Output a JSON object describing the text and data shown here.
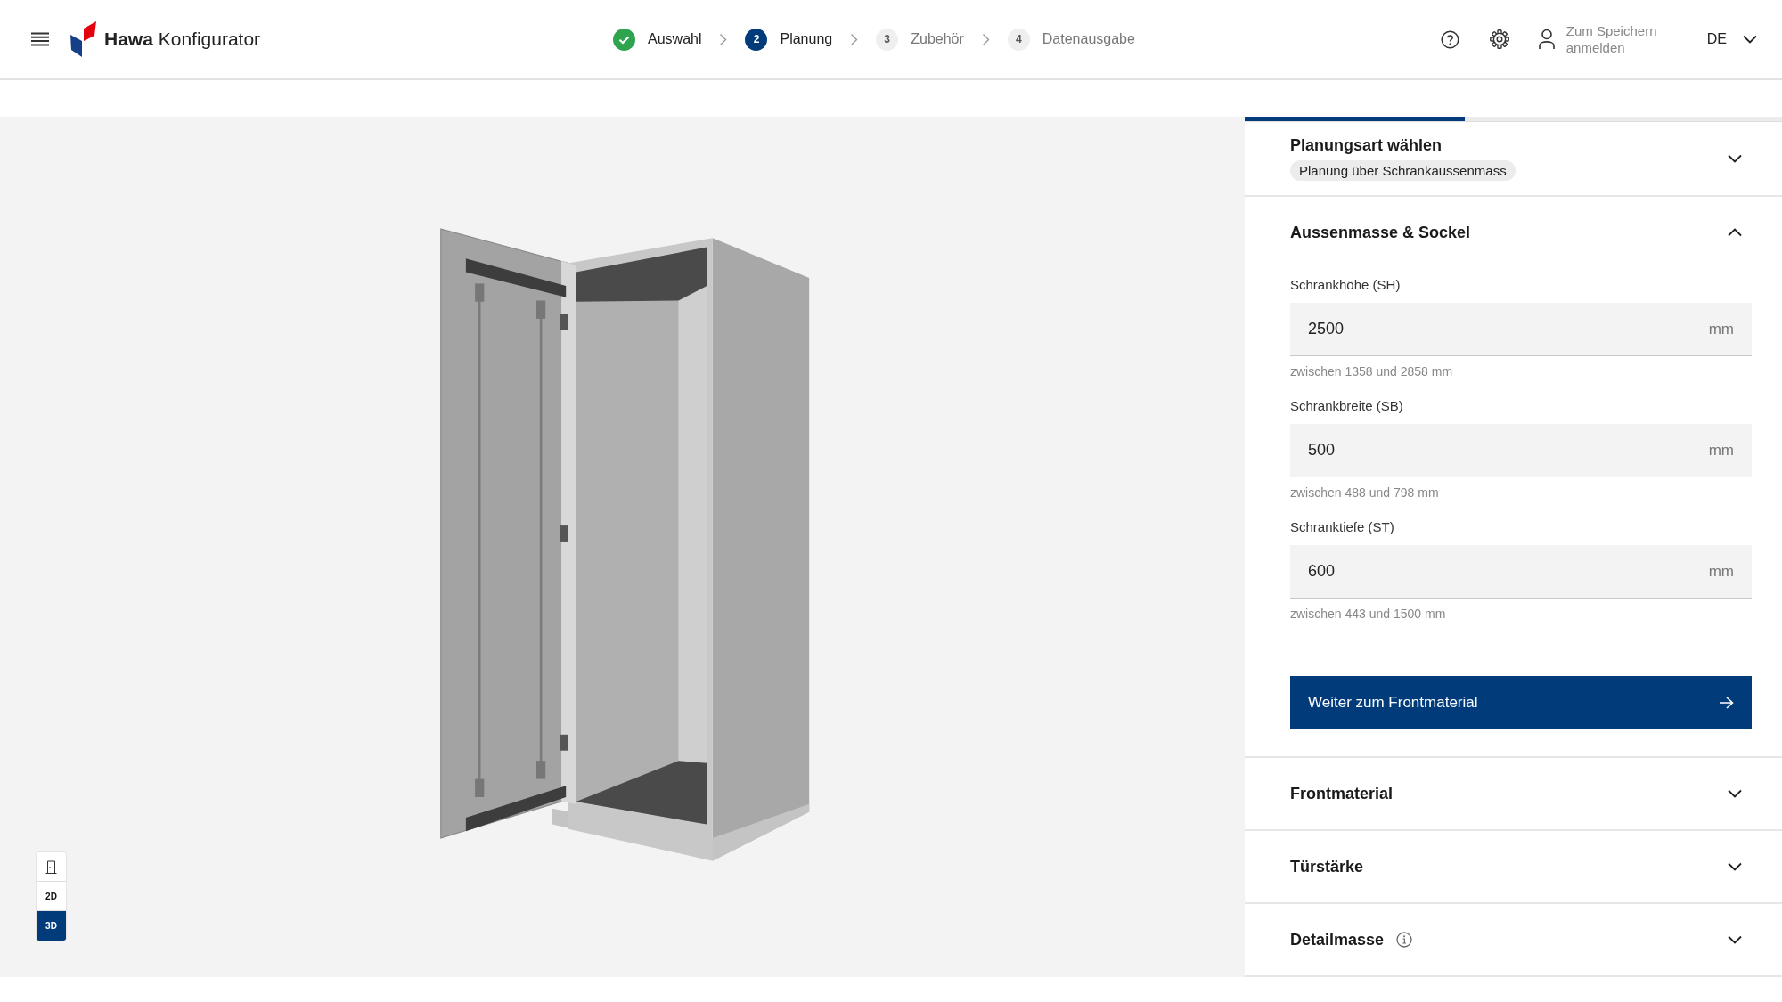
{
  "header": {
    "brand": "**Hawa** Konfigurator",
    "steps": [
      {
        "kind": "done",
        "label": "Auswahl"
      },
      {
        "kind": "current",
        "number": "2",
        "label": "Planung"
      },
      {
        "kind": "upcoming",
        "number": "3",
        "label": "Zubehör"
      },
      {
        "kind": "upcoming",
        "number": "4",
        "label": "Datenausgabe"
      }
    ],
    "login": "Zum Speichern anmelden",
    "language": "DE"
  },
  "viewer": {
    "view_modes": [
      {
        "kind": "door",
        "selected": false
      },
      {
        "kind": "text",
        "label": "2D",
        "selected": false
      },
      {
        "kind": "text",
        "label": "3D",
        "selected": true
      }
    ]
  },
  "panel": {
    "progress": {
      "level": 0.41
    },
    "sections": [
      {
        "title": "Planungsart wählen",
        "expanded": false,
        "chip": "Planung über Schrankaussenmass"
      },
      {
        "title": "Aussenmasse & Sockel",
        "expanded": true,
        "fields": [
          {
            "label": "Schrankhöhe (SH)",
            "value": "2500",
            "unit": "mm",
            "hint": "zwischen 1358 und 2858 mm"
          },
          {
            "label": "Schrankbreite (SB)",
            "value": "500",
            "unit": "mm",
            "hint": "zwischen 488 und 798 mm"
          },
          {
            "label": "Schranktiefe (ST)",
            "value": "600",
            "unit": "mm",
            "hint": "zwischen 443 und 1500 mm"
          }
        ],
        "button": "Weiter zum Frontmaterial"
      },
      {
        "title": "Frontmaterial",
        "expanded": false
      },
      {
        "title": "Türstärke",
        "expanded": false
      },
      {
        "title": "Detailmasse",
        "expanded": false,
        "info": true
      }
    ]
  }
}
